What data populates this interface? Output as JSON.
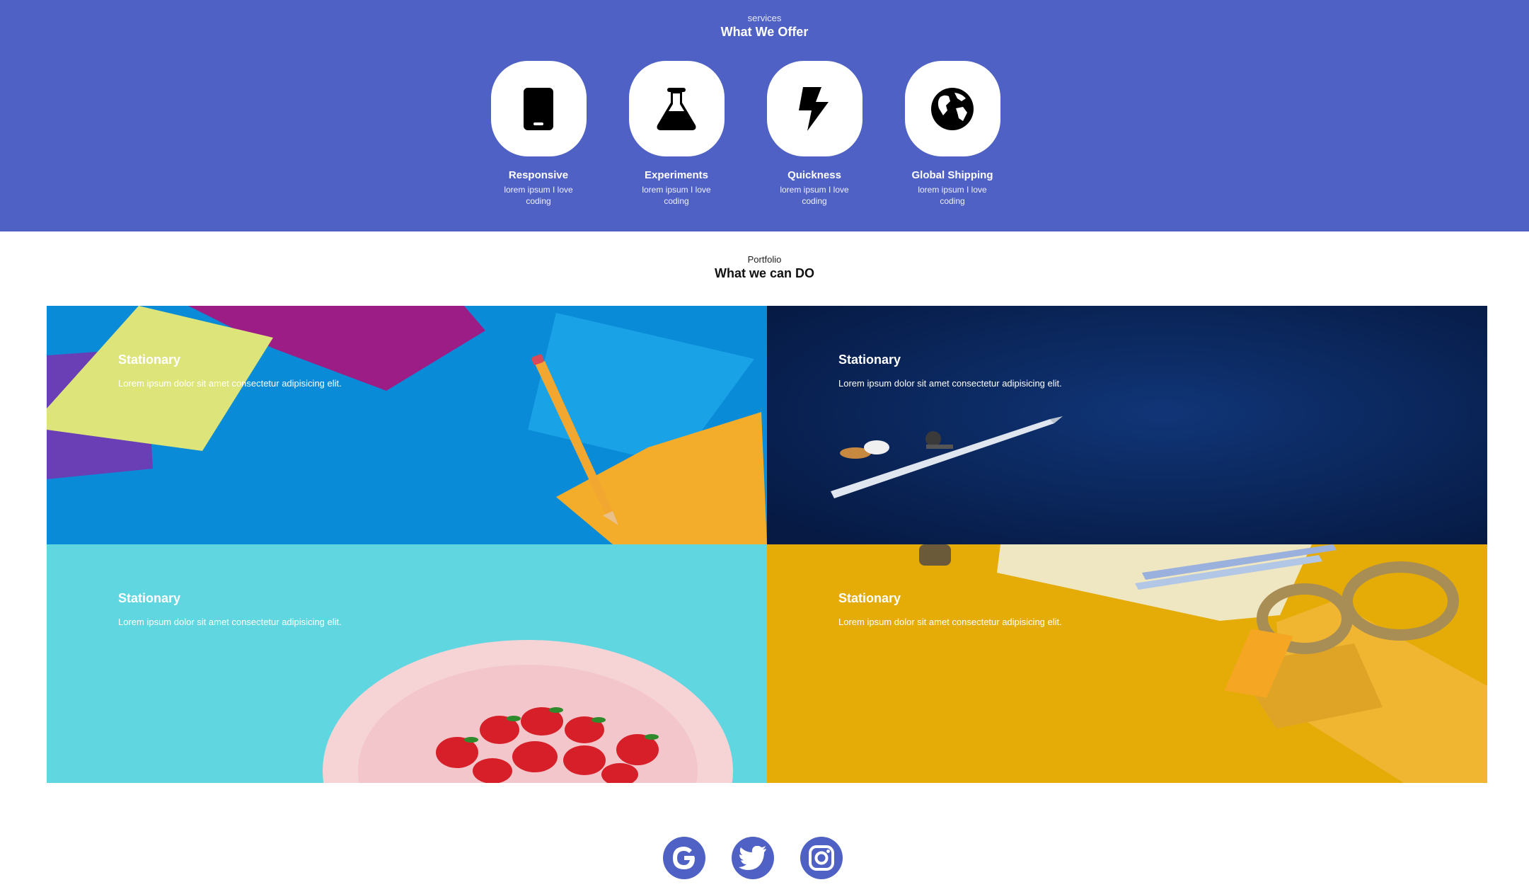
{
  "services": {
    "eyebrow": "services",
    "heading": "What We Offer",
    "items": [
      {
        "icon": "mobile-icon",
        "title": "Responsive",
        "desc": "lorem ipsum I love coding"
      },
      {
        "icon": "flask-icon",
        "title": "Experiments",
        "desc": "lorem ipsum I love coding"
      },
      {
        "icon": "lightning-icon",
        "title": "Quickness",
        "desc": "lorem ipsum I love coding"
      },
      {
        "icon": "globe-icon",
        "title": "Global Shipping",
        "desc": "lorem ipsum I love coding"
      }
    ]
  },
  "portfolio": {
    "eyebrow": "Portfolio",
    "heading": "What we can DO",
    "cards": [
      {
        "title": "Stationary",
        "text": "Lorem ipsum dolor sit amet consectetur adipisicing elit.",
        "bg": "#0a8bd8"
      },
      {
        "title": "Stationary",
        "text": "Lorem ipsum dolor sit amet consectetur adipisicing elit.",
        "bg": "#0b2a63"
      },
      {
        "title": "Stationary",
        "text": "Lorem ipsum dolor sit amet consectetur adipisicing elit.",
        "bg": "#5fd6e0"
      },
      {
        "title": "Stationary",
        "text": "Lorem ipsum dolor sit amet consectetur adipisicing elit.",
        "bg": "#e5ac07"
      }
    ]
  },
  "social": {
    "items": [
      {
        "icon": "google-icon"
      },
      {
        "icon": "twitter-icon"
      },
      {
        "icon": "instagram-icon"
      }
    ]
  },
  "colors": {
    "accent": "#4f61c4",
    "white": "#ffffff"
  }
}
